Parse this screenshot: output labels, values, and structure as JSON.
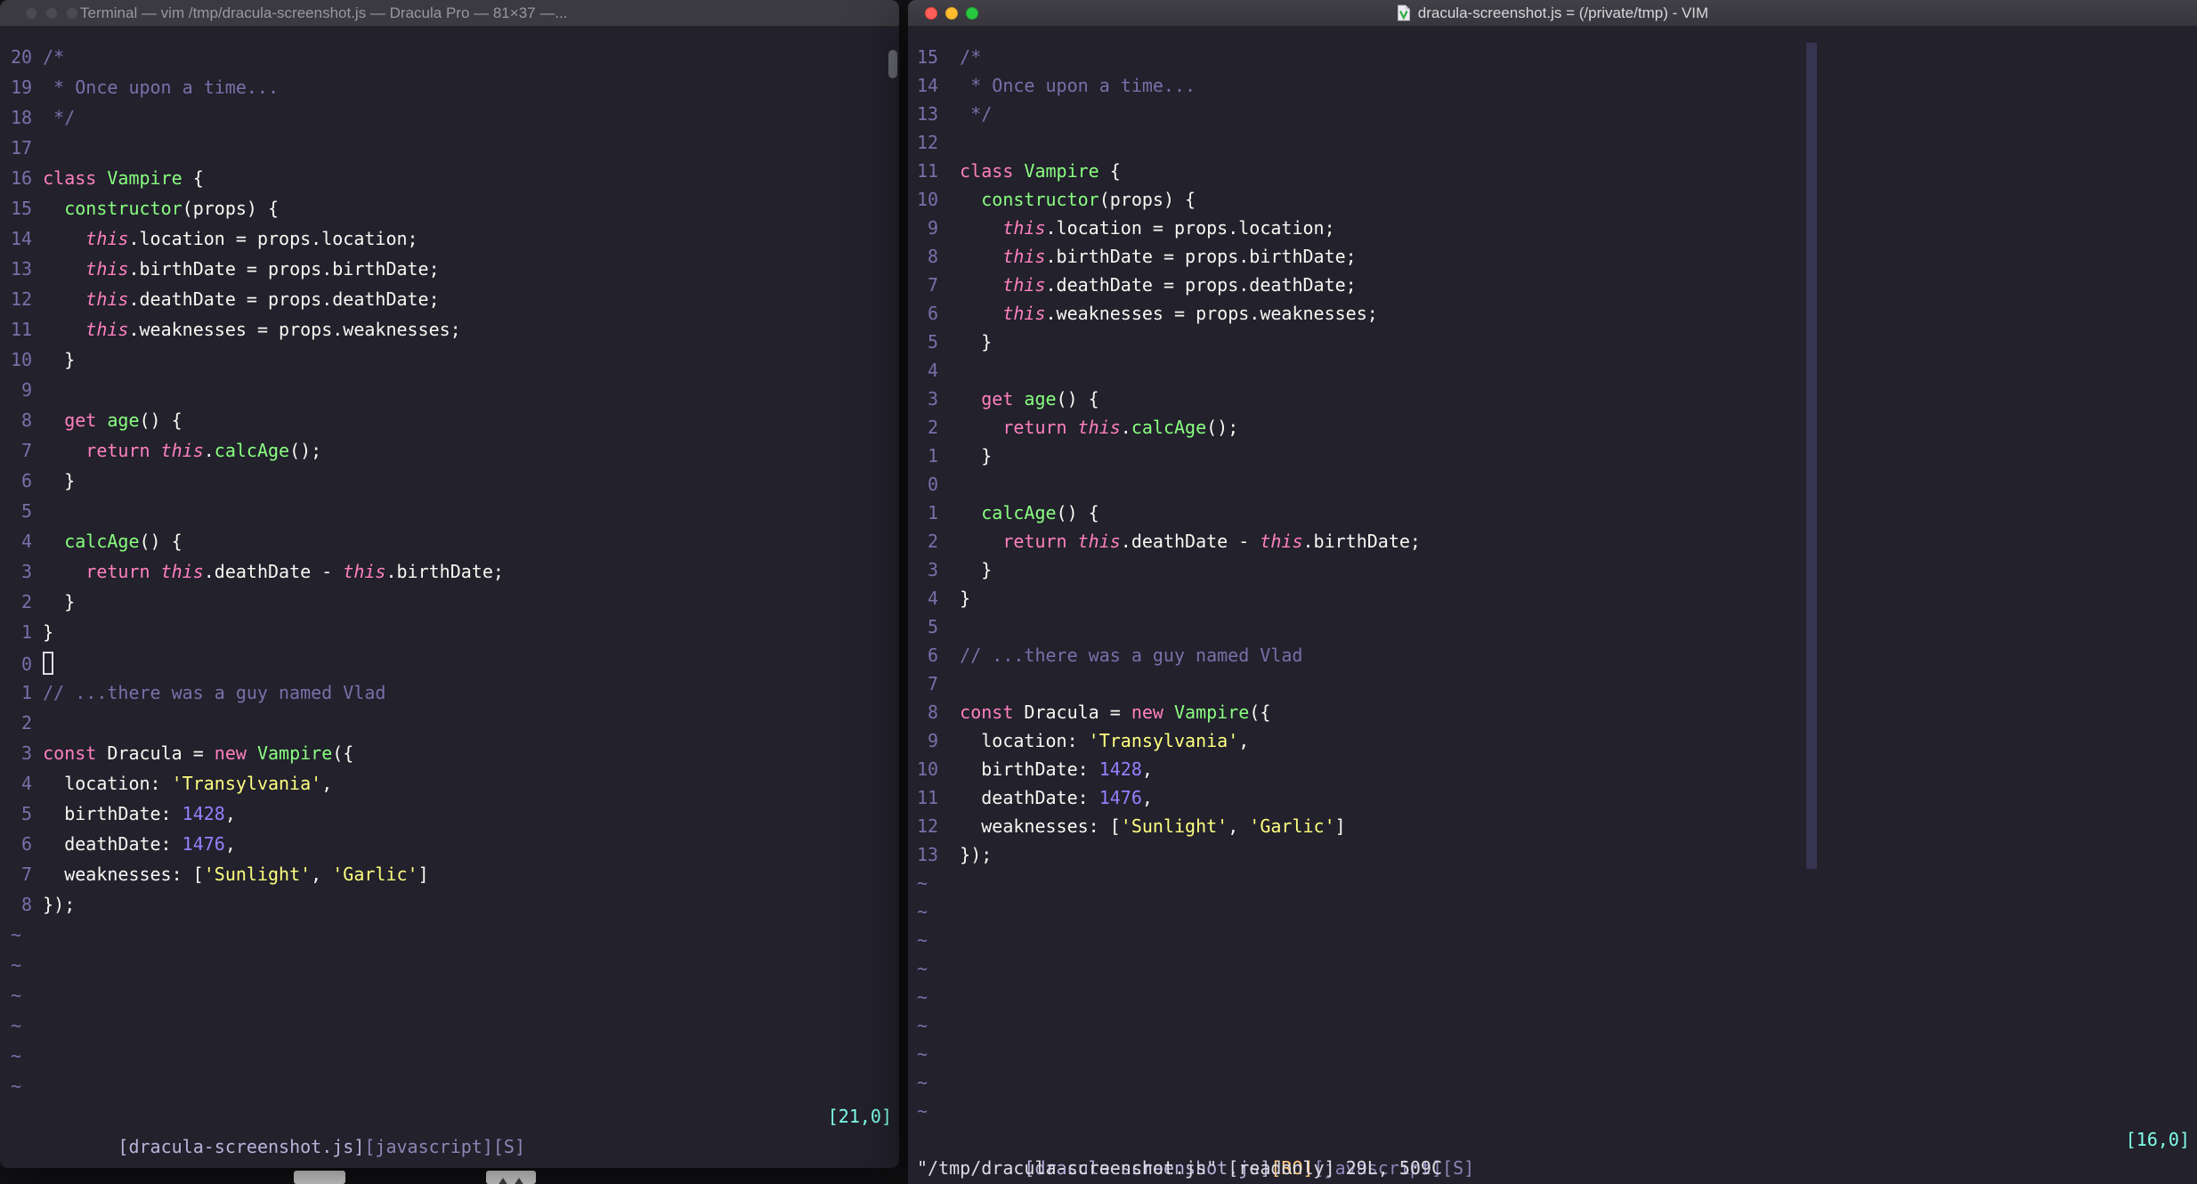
{
  "tilde": "~",
  "colors": {
    "background": "#22212C",
    "foreground": "#F8F8F2",
    "comment": "#7970A9",
    "keyword_pink": "#FF80BF",
    "function_green": "#8AFF80",
    "string_yellow": "#FFFF80",
    "number_purple": "#9580FF",
    "status_cyan": "#80FFEA",
    "readonly_orange": "#FFCA80",
    "traffic_red": "#FF5F58",
    "traffic_yellow": "#FFBD2E",
    "traffic_green": "#28C840"
  },
  "left_window": {
    "title": "Terminal — vim /tmp/dracula-screenshot.js — Dracula Pro — 81×37 —...",
    "cursor_line": 21,
    "cursor_style": "hollow",
    "tilde_rows": 6,
    "status": {
      "file": "[dracula-screenshot.js]",
      "meta": "[javascript][S]",
      "pos": "[21,0]"
    }
  },
  "right_window": {
    "title": "dracula-screenshot.js = (/private/tmp) - VIM",
    "cursor_line": 16,
    "cursor_style": "none",
    "tilde_rows": 9,
    "status": {
      "file": "[dracula-screenshot.js]",
      "ro": "[RO]",
      "meta": "[javascript][S]",
      "pos": "[16,0]"
    },
    "command_line": "\"/tmp/dracula-screenshot.js\" [readonly] 29L, 509C"
  },
  "code_lines": [
    [
      [
        "c",
        "/*"
      ]
    ],
    [
      [
        "c",
        " * Once upon a time..."
      ]
    ],
    [
      [
        "c",
        " */"
      ]
    ],
    [],
    [
      [
        "k",
        "class "
      ],
      [
        "g",
        "Vampire"
      ],
      [
        "f",
        " {"
      ]
    ],
    [
      [
        "f",
        "  "
      ],
      [
        "g",
        "constructor"
      ],
      [
        "f",
        "(props) {"
      ]
    ],
    [
      [
        "f",
        "    "
      ],
      [
        "t",
        "this"
      ],
      [
        "f",
        ".location = props.location;"
      ]
    ],
    [
      [
        "f",
        "    "
      ],
      [
        "t",
        "this"
      ],
      [
        "f",
        ".birthDate = props.birthDate;"
      ]
    ],
    [
      [
        "f",
        "    "
      ],
      [
        "t",
        "this"
      ],
      [
        "f",
        ".deathDate = props.deathDate;"
      ]
    ],
    [
      [
        "f",
        "    "
      ],
      [
        "t",
        "this"
      ],
      [
        "f",
        ".weaknesses = props.weaknesses;"
      ]
    ],
    [
      [
        "f",
        "  }"
      ]
    ],
    [],
    [
      [
        "f",
        "  "
      ],
      [
        "k",
        "get "
      ],
      [
        "g",
        "age"
      ],
      [
        "f",
        "() {"
      ]
    ],
    [
      [
        "f",
        "    "
      ],
      [
        "k",
        "return "
      ],
      [
        "t",
        "this"
      ],
      [
        "f",
        "."
      ],
      [
        "g",
        "calcAge"
      ],
      [
        "f",
        "();"
      ]
    ],
    [
      [
        "f",
        "  }"
      ]
    ],
    [],
    [
      [
        "f",
        "  "
      ],
      [
        "g",
        "calcAge"
      ],
      [
        "f",
        "() {"
      ]
    ],
    [
      [
        "f",
        "    "
      ],
      [
        "k",
        "return "
      ],
      [
        "t",
        "this"
      ],
      [
        "f",
        ".deathDate - "
      ],
      [
        "t",
        "this"
      ],
      [
        "f",
        ".birthDate;"
      ]
    ],
    [
      [
        "f",
        "  }"
      ]
    ],
    [
      [
        "f",
        "}"
      ]
    ],
    [],
    [
      [
        "c",
        "// ...there was a guy named Vlad"
      ]
    ],
    [],
    [
      [
        "k",
        "const "
      ],
      [
        "f",
        "Dracula = "
      ],
      [
        "k",
        "new "
      ],
      [
        "g",
        "Vampire"
      ],
      [
        "f",
        "({"
      ]
    ],
    [
      [
        "f",
        "  location: "
      ],
      [
        "s",
        "'Transylvania'"
      ],
      [
        "f",
        ","
      ]
    ],
    [
      [
        "f",
        "  birthDate: "
      ],
      [
        "n",
        "1428"
      ],
      [
        "f",
        ","
      ]
    ],
    [
      [
        "f",
        "  deathDate: "
      ],
      [
        "n",
        "1476"
      ],
      [
        "f",
        ","
      ]
    ],
    [
      [
        "f",
        "  weaknesses: ["
      ],
      [
        "s",
        "'Sunlight'"
      ],
      [
        "f",
        ", "
      ],
      [
        "s",
        "'Garlic'"
      ],
      [
        "f",
        "]"
      ]
    ],
    [
      [
        "f",
        "});"
      ]
    ]
  ]
}
